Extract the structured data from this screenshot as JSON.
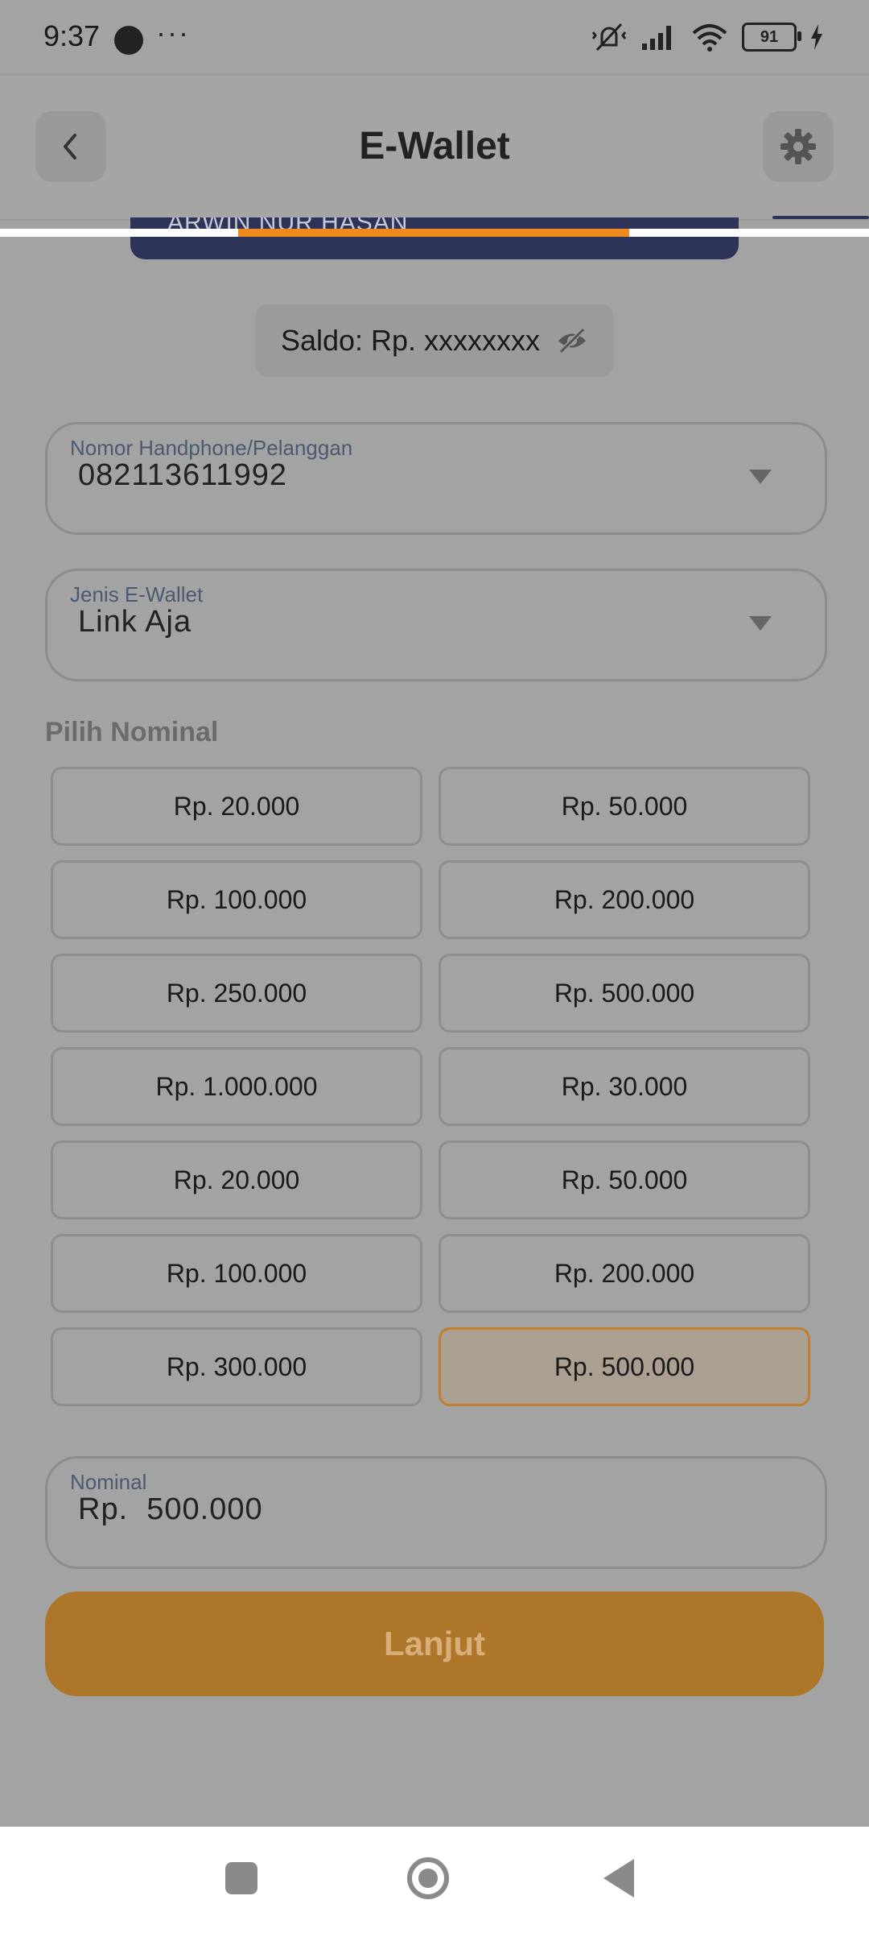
{
  "status_bar": {
    "time": "9:37",
    "more": "···",
    "battery": "91"
  },
  "header": {
    "title": "E-Wallet"
  },
  "card": {
    "holder_name": "ARWIN NUR HASAN"
  },
  "saldo": {
    "text": "Saldo: Rp. xxxxxxxx"
  },
  "phone_field": {
    "label": "Nomor Handphone/Pelanggan",
    "value": "082113611992"
  },
  "wallet_field": {
    "label": "Jenis E-Wallet",
    "value": "Link Aja"
  },
  "nominal_section": {
    "label": "Pilih Nominal",
    "options": [
      "Rp. 20.000",
      "Rp. 50.000",
      "Rp. 100.000",
      "Rp. 200.000",
      "Rp. 250.000",
      "Rp. 500.000",
      "Rp. 1.000.000",
      "Rp. 30.000",
      "Rp. 20.000",
      "Rp. 50.000",
      "Rp. 100.000",
      "Rp. 200.000",
      "Rp. 300.000",
      "Rp. 500.000"
    ]
  },
  "nominal_field": {
    "label": "Nominal",
    "value": "Rp.  500.000"
  },
  "actions": {
    "submit_label": "Lanjut"
  },
  "colors": {
    "accent": "#ae7629",
    "selected_border": "#c07e2e",
    "card": "#2e3358"
  }
}
